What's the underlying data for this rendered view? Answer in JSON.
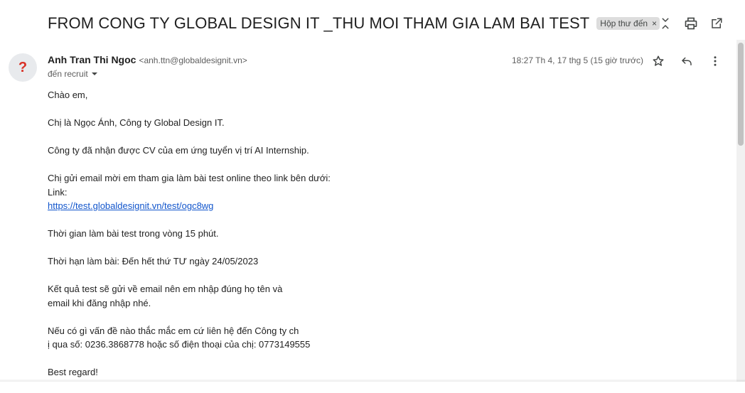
{
  "email": {
    "subject": "FROM CONG TY GLOBAL DESIGN IT _THU MOI THAM GIA LAM BAI TEST",
    "label": "Hộp thư đến",
    "label_remove": "×",
    "sender_name": "Anh Tran Thi Ngoc",
    "sender_email": "<anh.ttn@globaldesignit.vn>",
    "recipient": "đến recruit",
    "date": "18:27 Th 4, 17 thg 5 (15 giờ trước)",
    "avatar_glyph": "?"
  },
  "body": {
    "greeting": "Chào em,",
    "intro": "Chị là Ngọc Ánh, Công ty Global Design IT.",
    "received": "Công ty  đã nhận được CV của em ứng tuyển vị trí AI Internship.",
    "invite": "Chị gửi email mời em tham gia làm bài test online theo link bên dưới:",
    "link_label": "Link:",
    "link": "https://test.globaldesignit.vn/test/ogc8wg",
    "duration": "Thời gian làm bài test trong vòng 15 phút.",
    "deadline": "Thời hạn làm bài: Đến hết thứ TƯ ngày 24/05/2023",
    "result_1": "Kết quả  test sẽ gửi về email nên em  nhập đúng họ tên và",
    "result_2": "email khi đăng  nhập nhé.",
    "contact_1": "Nếu có gì vấn đề nào thắc mắc em cứ liên hệ đến Công ty ch",
    "contact_2": "ị qua số: 0236.3868778 hoặc số điện thoại của chị: 0773149555",
    "closing": "Best regard!"
  },
  "icons": {
    "collapse": "unfold-less-icon",
    "print": "print-icon",
    "popout": "open-in-new-icon",
    "star": "star-icon",
    "reply": "reply-icon",
    "more": "more-vert-icon",
    "recipient_dropdown": "arrow-drop-down-icon"
  },
  "colors": {
    "link": "#1155cc",
    "label_chip_bg": "#dddddd",
    "avatar_glyph": "#d93025"
  }
}
